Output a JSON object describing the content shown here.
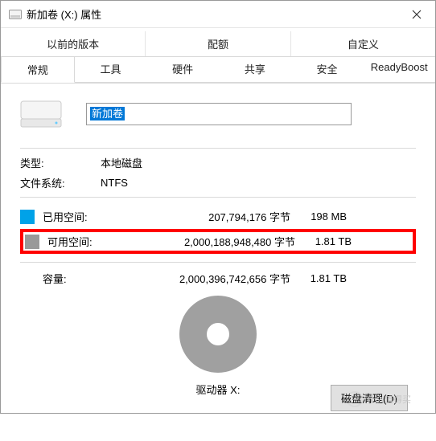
{
  "window": {
    "title": "新加卷 (X:) 属性",
    "close_icon": "close-icon"
  },
  "tabs_row1": [
    {
      "label": "以前的版本"
    },
    {
      "label": "配额"
    },
    {
      "label": "自定义"
    }
  ],
  "tabs_row2": [
    {
      "label": "常规",
      "active": true
    },
    {
      "label": "工具"
    },
    {
      "label": "硬件"
    },
    {
      "label": "共享"
    },
    {
      "label": "安全"
    },
    {
      "label": "ReadyBoost"
    }
  ],
  "drive": {
    "name_value": "新加卷"
  },
  "meta": {
    "type_label": "类型:",
    "type_value": "本地磁盘",
    "fs_label": "文件系统:",
    "fs_value": "NTFS"
  },
  "space": {
    "used_label": "已用空间:",
    "used_bytes": "207,794,176 字节",
    "used_human": "198 MB",
    "free_label": "可用空间:",
    "free_bytes": "2,000,188,948,480 字节",
    "free_human": "1.81 TB",
    "capacity_label": "容量:",
    "capacity_bytes": "2,000,396,742,656 字节",
    "capacity_human": "1.81 TB"
  },
  "footer": {
    "drive_label": "驱动器 X:",
    "cleanup_button": "磁盘清理(D)"
  },
  "watermark": {
    "text": "什么值得买"
  },
  "chart_data": {
    "type": "pie",
    "title": "",
    "series": [
      {
        "name": "已用空间",
        "value": 207794176,
        "color": "#00a2e8"
      },
      {
        "name": "可用空间",
        "value": 2000188948480,
        "color": "#999999"
      }
    ]
  }
}
